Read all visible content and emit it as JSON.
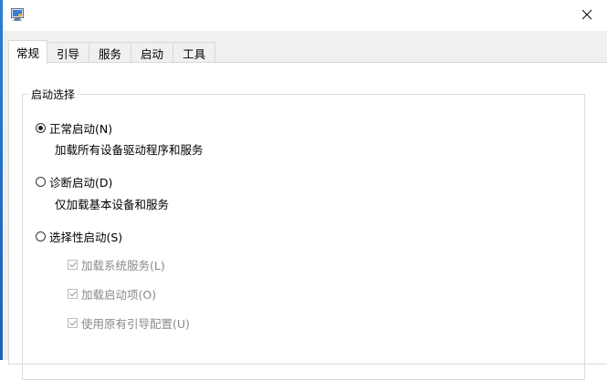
{
  "window": {
    "icon": "system-config-icon",
    "close_icon": "close-icon"
  },
  "tabs": [
    {
      "label": "常规",
      "active": true
    },
    {
      "label": "引导",
      "active": false
    },
    {
      "label": "服务",
      "active": false
    },
    {
      "label": "启动",
      "active": false
    },
    {
      "label": "工具",
      "active": false
    }
  ],
  "startup_selection": {
    "group_label": "启动选择",
    "normal": {
      "label": "正常启动(N)",
      "description": "加载所有设备驱动程序和服务",
      "selected": true
    },
    "diagnostic": {
      "label": "诊断启动(D)",
      "description": "仅加载基本设备和服务",
      "selected": false
    },
    "selective": {
      "label": "选择性启动(S)",
      "selected": false,
      "options": [
        {
          "label": "加载系统服务(L)",
          "checked": true,
          "enabled": false
        },
        {
          "label": "加载启动项(O)",
          "checked": true,
          "enabled": false
        },
        {
          "label": "使用原有引导配置(U)",
          "checked": true,
          "enabled": false
        }
      ]
    }
  }
}
